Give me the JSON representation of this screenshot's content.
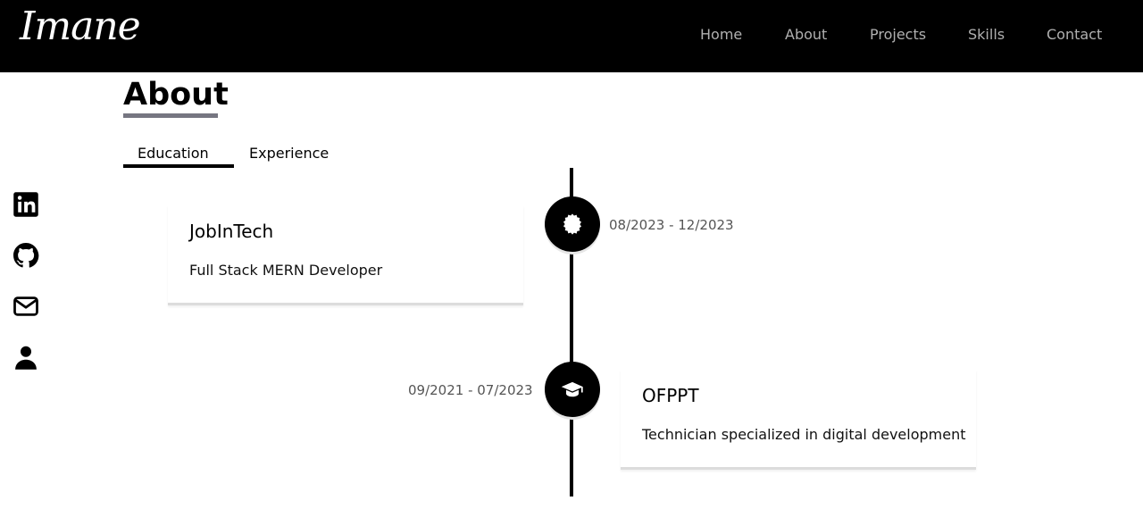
{
  "header": {
    "logo": "Imane",
    "nav": [
      "Home",
      "About",
      "Projects",
      "Skills",
      "Contact"
    ]
  },
  "social": [
    {
      "icon": "linkedin-icon"
    },
    {
      "icon": "github-icon"
    },
    {
      "icon": "mail-icon"
    },
    {
      "icon": "user-icon"
    }
  ],
  "about": {
    "title": "About",
    "tabs": [
      "Education",
      "Experience"
    ],
    "active_tab": "Education",
    "timeline": [
      {
        "icon": "certificate-icon",
        "title": "JobInTech",
        "subtitle": "Full Stack MERN Developer",
        "date": "08/2023 - 12/2023"
      },
      {
        "icon": "graduation-cap-icon",
        "title": "OFPPT",
        "subtitle": "Technician specialized in digital development",
        "date": "09/2021 - 07/2023"
      }
    ]
  },
  "colors": {
    "navbar_bg": "#000000",
    "nav_text": "#b0b0b0",
    "accent_underline": "#767681",
    "timeline": "#000000"
  }
}
